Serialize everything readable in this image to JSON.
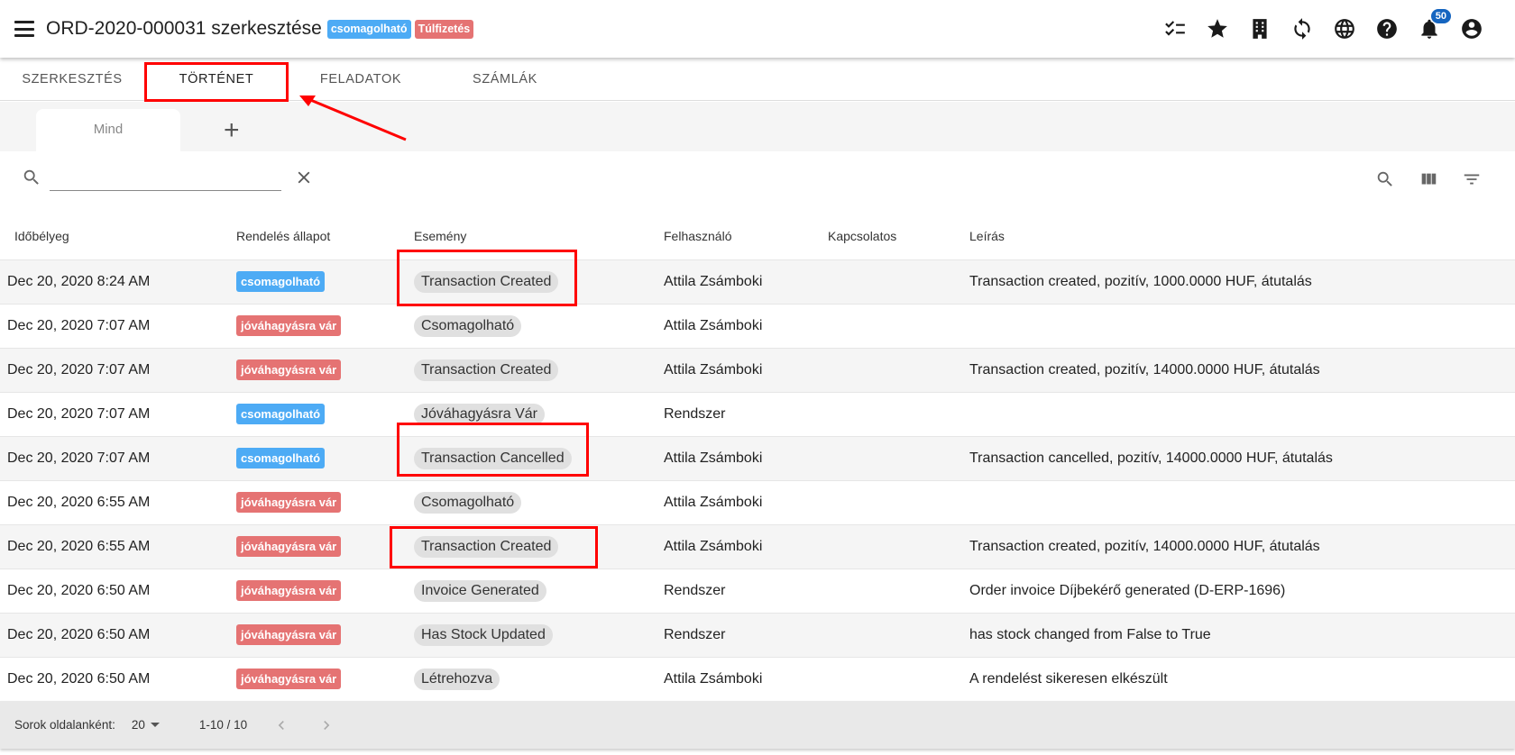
{
  "header": {
    "title": "ORD-2020-000031 szerkesztése",
    "badges": [
      "csomagolható",
      "Túlfizetés"
    ],
    "notification_count": "50",
    "icons": [
      "checklist-icon",
      "star-icon",
      "building-icon",
      "sync-icon",
      "globe-icon",
      "help-icon",
      "bell-icon",
      "account-icon"
    ]
  },
  "tabs": [
    {
      "label": "SZERKESZTÉS"
    },
    {
      "label": "TÖRTÉNET"
    },
    {
      "label": "FELADATOK"
    },
    {
      "label": "SZÁMLÁK"
    }
  ],
  "subtabs": {
    "active": "Mind",
    "add": "+"
  },
  "search": {
    "value": "",
    "placeholder": ""
  },
  "table": {
    "columns": [
      "Időbélyeg",
      "Rendelés állapot",
      "Esemény",
      "Felhasználó",
      "Kapcsolatos",
      "Leírás"
    ],
    "rows": [
      {
        "time": "Dec 20, 2020 8:24 AM",
        "status": "csomagolható",
        "event": "Transaction Created",
        "user": "Attila Zsámboki",
        "related": "",
        "desc": "Transaction created, pozitív, 1000.0000 HUF, átutalás"
      },
      {
        "time": "Dec 20, 2020 7:07 AM",
        "status": "jóváhagyásra vár",
        "event": "Csomagolható",
        "user": "Attila Zsámboki",
        "related": "",
        "desc": ""
      },
      {
        "time": "Dec 20, 2020 7:07 AM",
        "status": "jóváhagyásra vár",
        "event": "Transaction Created",
        "user": "Attila Zsámboki",
        "related": "",
        "desc": "Transaction created, pozitív, 14000.0000 HUF, átutalás"
      },
      {
        "time": "Dec 20, 2020 7:07 AM",
        "status": "csomagolható",
        "event": "Jóváhagyásra Vár",
        "user": "Rendszer",
        "related": "",
        "desc": ""
      },
      {
        "time": "Dec 20, 2020 7:07 AM",
        "status": "csomagolható",
        "event": "Transaction Cancelled",
        "user": "Attila Zsámboki",
        "related": "",
        "desc": "Transaction cancelled, pozitív, 14000.0000 HUF, átutalás"
      },
      {
        "time": "Dec 20, 2020 6:55 AM",
        "status": "jóváhagyásra vár",
        "event": "Csomagolható",
        "user": "Attila Zsámboki",
        "related": "",
        "desc": ""
      },
      {
        "time": "Dec 20, 2020 6:55 AM",
        "status": "jóváhagyásra vár",
        "event": "Transaction Created",
        "user": "Attila Zsámboki",
        "related": "",
        "desc": "Transaction created, pozitív, 14000.0000 HUF, átutalás"
      },
      {
        "time": "Dec 20, 2020 6:50 AM",
        "status": "jóváhagyásra vár",
        "event": "Invoice Generated",
        "user": "Rendszer",
        "related": "",
        "desc": "Order invoice Díjbekérő generated (D-ERP-1696)"
      },
      {
        "time": "Dec 20, 2020 6:50 AM",
        "status": "jóváhagyásra vár",
        "event": "Has Stock Updated",
        "user": "Rendszer",
        "related": "",
        "desc": "has stock changed from False to True"
      },
      {
        "time": "Dec 20, 2020 6:50 AM",
        "status": "jóváhagyásra vár",
        "event": "Létrehozva",
        "user": "Attila Zsámboki",
        "related": "",
        "desc": "A rendelést sikeresen elkészült"
      }
    ]
  },
  "footer": {
    "rows_per_page_label": "Sorok oldalanként:",
    "rows_per_page": "20",
    "range": "1-10 / 10"
  },
  "colors": {
    "csomagolható": "#4dabf5",
    "jóváhagyásra vár": "#e57373",
    "Túlfizetés": "#e57373",
    "annotation": "#ff0000"
  }
}
